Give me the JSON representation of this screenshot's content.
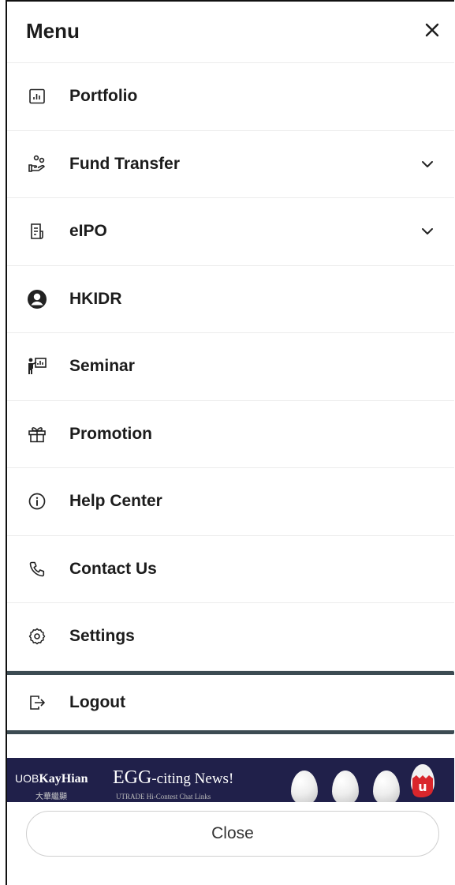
{
  "header": {
    "title": "Menu",
    "close_icon": "close-icon"
  },
  "menu": {
    "items": [
      {
        "label": "Portfolio",
        "icon": "chart-icon",
        "expandable": false
      },
      {
        "label": "Fund Transfer",
        "icon": "hand-coins-icon",
        "expandable": true
      },
      {
        "label": "eIPO",
        "icon": "document-icon",
        "expandable": true
      },
      {
        "label": "HKIDR",
        "icon": "user-circle-icon",
        "expandable": false
      },
      {
        "label": "Seminar",
        "icon": "presenter-icon",
        "expandable": false
      },
      {
        "label": "Promotion",
        "icon": "gift-icon",
        "expandable": false
      },
      {
        "label": "Help Center",
        "icon": "info-icon",
        "expandable": false
      },
      {
        "label": "Contact Us",
        "icon": "phone-icon",
        "expandable": false
      },
      {
        "label": "Settings",
        "icon": "gear-icon",
        "expandable": false
      },
      {
        "label": "Logout",
        "icon": "logout-icon",
        "expandable": false
      }
    ]
  },
  "banner": {
    "brand_prefix": "UOB",
    "brand_name": "KayHian",
    "brand_cn": "大華繼顯",
    "headline_big": "EGG",
    "headline_rest": "-citing News!",
    "subtext": "UTRADE Hi-Contest Chat Links",
    "background": "#20204a"
  },
  "footer": {
    "close_label": "Close"
  },
  "colors": {
    "text": "#1c1c1c",
    "divider": "#ececec",
    "highlight_border": "#3c4b52"
  }
}
